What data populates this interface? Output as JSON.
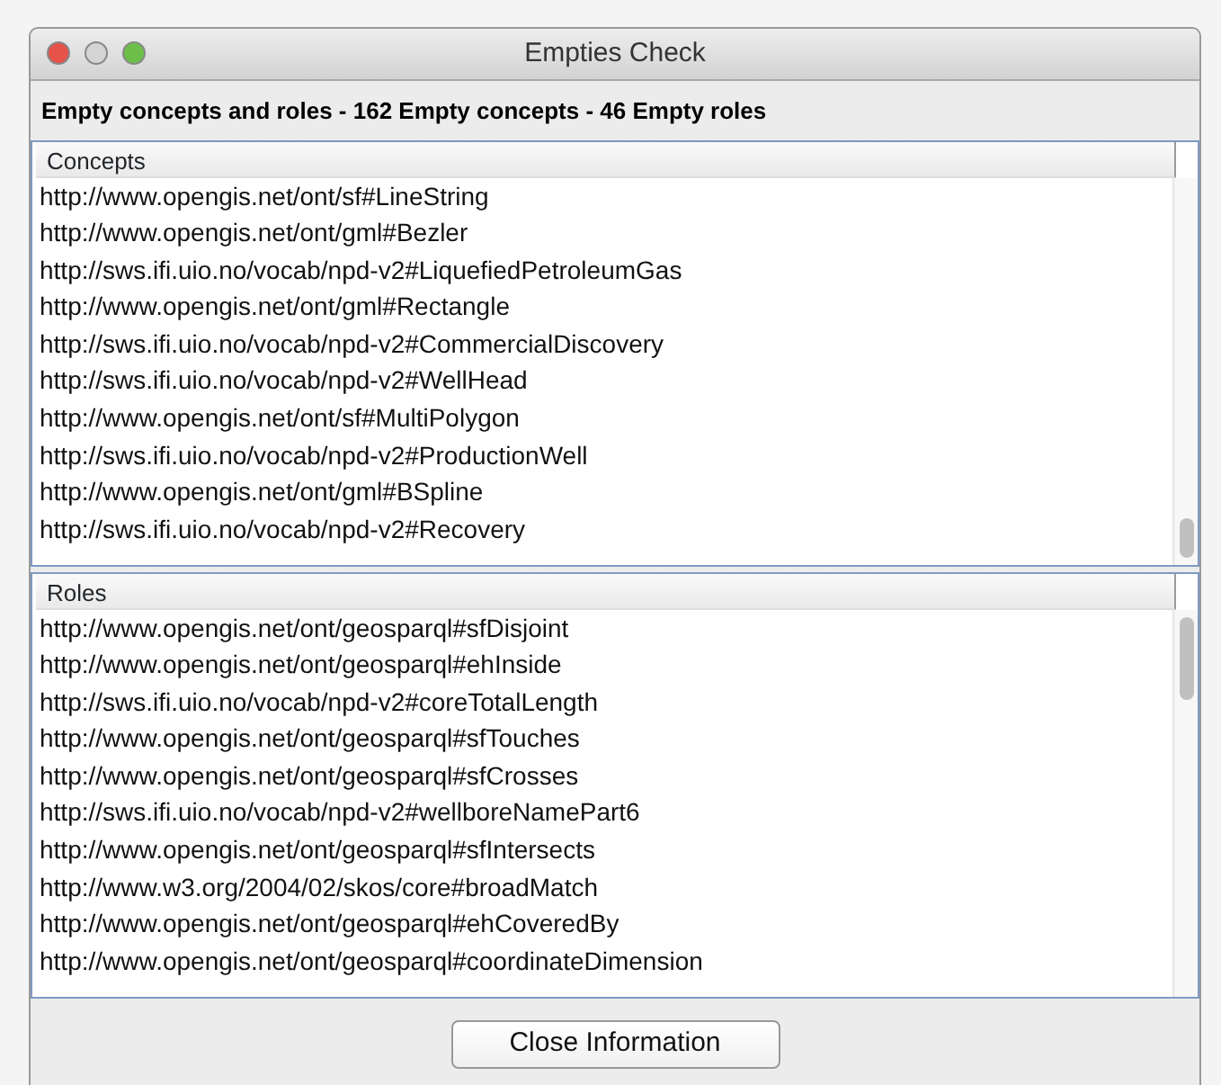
{
  "window": {
    "title": "Empties Check"
  },
  "summary": "Empty concepts and roles  - 162 Empty concepts - 46 Empty roles",
  "panels": [
    {
      "header": "Concepts",
      "items": [
        "http://www.opengis.net/ont/sf#LineString",
        "http://www.opengis.net/ont/gml#Bezler",
        "http://sws.ifi.uio.no/vocab/npd-v2#LiquefiedPetroleumGas",
        "http://www.opengis.net/ont/gml#Rectangle",
        "http://sws.ifi.uio.no/vocab/npd-v2#CommercialDiscovery",
        "http://sws.ifi.uio.no/vocab/npd-v2#WellHead",
        "http://www.opengis.net/ont/sf#MultiPolygon",
        "http://sws.ifi.uio.no/vocab/npd-v2#ProductionWell",
        "http://www.opengis.net/ont/gml#BSpline",
        "http://sws.ifi.uio.no/vocab/npd-v2#Recovery"
      ]
    },
    {
      "header": "Roles",
      "items": [
        "http://www.opengis.net/ont/geosparql#sfDisjoint",
        "http://www.opengis.net/ont/geosparql#ehInside",
        "http://sws.ifi.uio.no/vocab/npd-v2#coreTotalLength",
        "http://www.opengis.net/ont/geosparql#sfTouches",
        "http://www.opengis.net/ont/geosparql#sfCrosses",
        "http://sws.ifi.uio.no/vocab/npd-v2#wellboreNamePart6",
        "http://www.opengis.net/ont/geosparql#sfIntersects",
        "http://www.w3.org/2004/02/skos/core#broadMatch",
        "http://www.opengis.net/ont/geosparql#ehCoveredBy",
        "http://www.opengis.net/ont/geosparql#coordinateDimension"
      ]
    }
  ],
  "button": "Close Information"
}
